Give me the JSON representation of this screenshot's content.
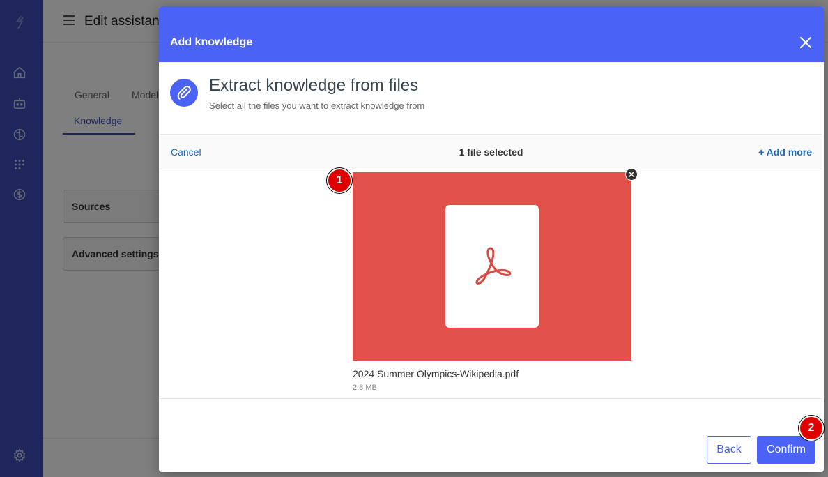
{
  "background": {
    "page_title": "Edit assistan",
    "tabs": [
      {
        "label": "General"
      },
      {
        "label": "Model"
      },
      {
        "label": "Knowledge"
      }
    ],
    "panels": [
      {
        "label": "Sources"
      },
      {
        "label": "Advanced settings"
      }
    ]
  },
  "sidebar": {
    "icons": [
      "logo-icon",
      "home-icon",
      "bot-icon",
      "brain-icon",
      "dots-icon",
      "dollar-icon",
      "settings-icon"
    ]
  },
  "modal": {
    "title": "Add knowledge",
    "section_title": "Extract knowledge from files",
    "section_subtitle": "Select all the files you want to extract knowledge from",
    "dashboard": {
      "cancel_label": "Cancel",
      "status": "1 file selected",
      "add_more_label": "+ Add more",
      "file": {
        "name": "2024 Summer Olympics-Wikipedia.pdf",
        "size": "2.8 MB"
      }
    },
    "back_label": "Back",
    "confirm_label": "Confirm"
  },
  "markers": [
    "1",
    "2"
  ],
  "colors": {
    "sidebar": "#3d4db7",
    "accent": "#4a63f5",
    "pdf_card": "#e25149",
    "marker": "#e00000"
  }
}
